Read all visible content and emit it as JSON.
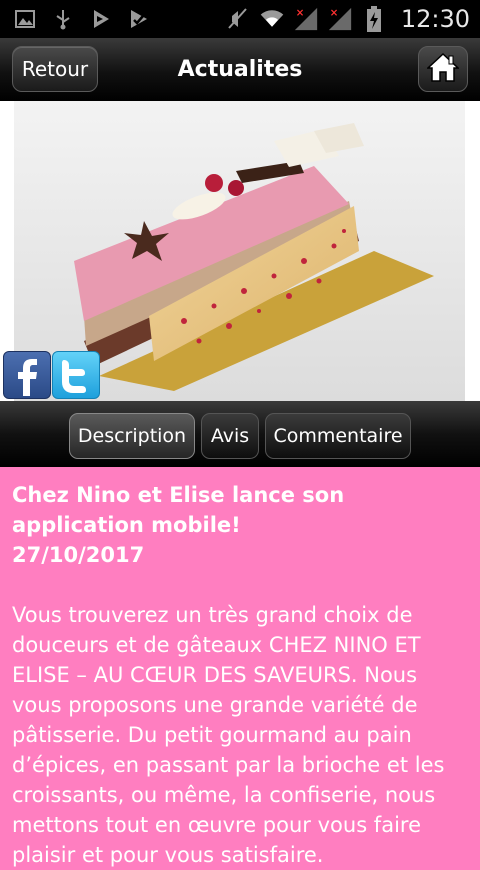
{
  "status_bar": {
    "time": "12:30",
    "left_icons": [
      "image-icon",
      "usb-icon",
      "play-store-icon",
      "play-store-check-icon"
    ],
    "right_icons": [
      "mute-icon",
      "wifi-icon",
      "signal-no-service-icon",
      "signal-no-service-icon",
      "battery-charging-icon"
    ]
  },
  "header": {
    "back_label": "Retour",
    "title": "Actualites",
    "home_icon": "home-icon"
  },
  "social": {
    "facebook_icon": "facebook-icon",
    "twitter_icon": "twitter-icon"
  },
  "tabs": [
    {
      "label": "Description",
      "active": true
    },
    {
      "label": "Avis",
      "active": false
    },
    {
      "label": "Commentaire",
      "active": false
    }
  ],
  "article": {
    "headline": "Chez Nino et Elise lance son application mobile!",
    "date": "27/10/2017",
    "body": "Vous trouverez un très grand choix de douceurs et de gâteaux CHEZ NINO ET ELISE – AU CŒUR DES SAVEURS. Nous vous proposons une grande variété de pâtisserie. Du petit gourmand au pain d’épices, en passant par la brioche et les croissants, ou même, la confiserie, nous mettons tout en œuvre pour vous faire plaisir et pour vous satisfaire."
  },
  "colors": {
    "content_background": "#ff7ec0",
    "header_background": "#111111"
  }
}
